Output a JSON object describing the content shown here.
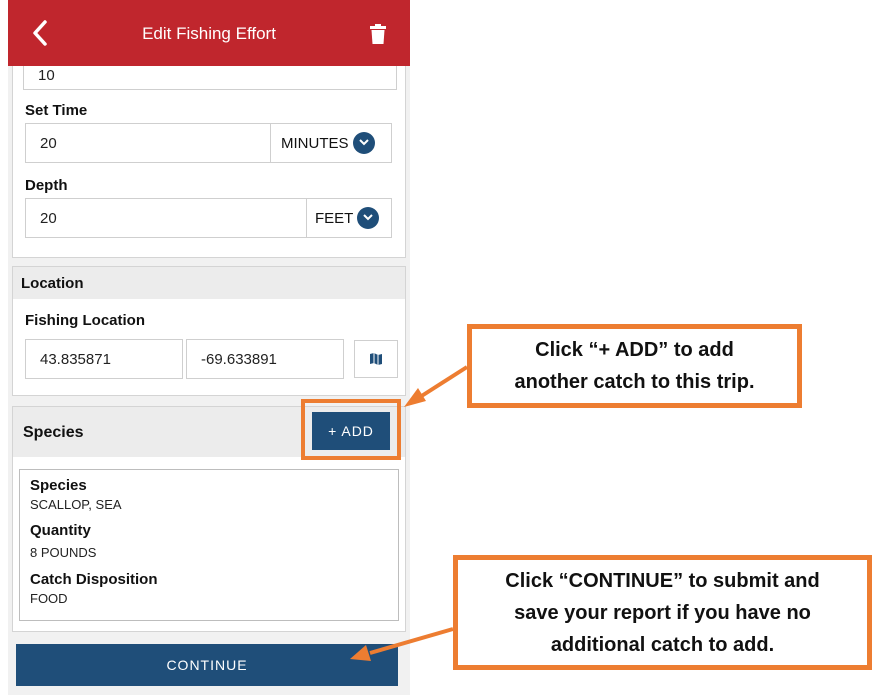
{
  "header": {
    "title": "Edit Fishing Effort"
  },
  "effort": {
    "top_value": "10",
    "set_time_label": "Set Time",
    "set_time_value": "20",
    "set_time_unit": "MINUTES",
    "depth_label": "Depth",
    "depth_value": "20",
    "depth_unit": "FEET"
  },
  "location": {
    "section_title": "Location",
    "field_label": "Fishing Location",
    "latitude": "43.835871",
    "longitude": "-69.633891"
  },
  "species_section": {
    "title": "Species",
    "add_label": "+ ADD",
    "card": {
      "species_label": "Species",
      "species_value": "SCALLOP, SEA",
      "quantity_label": "Quantity",
      "quantity_value": "8 POUNDS",
      "disposition_label": "Catch Disposition",
      "disposition_value": "FOOD"
    }
  },
  "continue_label": "CONTINUE",
  "callouts": {
    "add": {
      "line1": "Click “+ ADD” to add",
      "line2": "another catch to this trip."
    },
    "continue": {
      "line1": "Click “CONTINUE” to submit and",
      "line2": "save your report if you have no",
      "line3": "additional catch to add."
    }
  },
  "colors": {
    "header": "#c0262d",
    "primary": "#1f4e79",
    "callout_border": "#ed7d31"
  },
  "icons": {
    "back": "chevron-left-icon",
    "delete": "trash-icon",
    "dropdown": "chevron-down-icon",
    "map": "map-icon"
  }
}
